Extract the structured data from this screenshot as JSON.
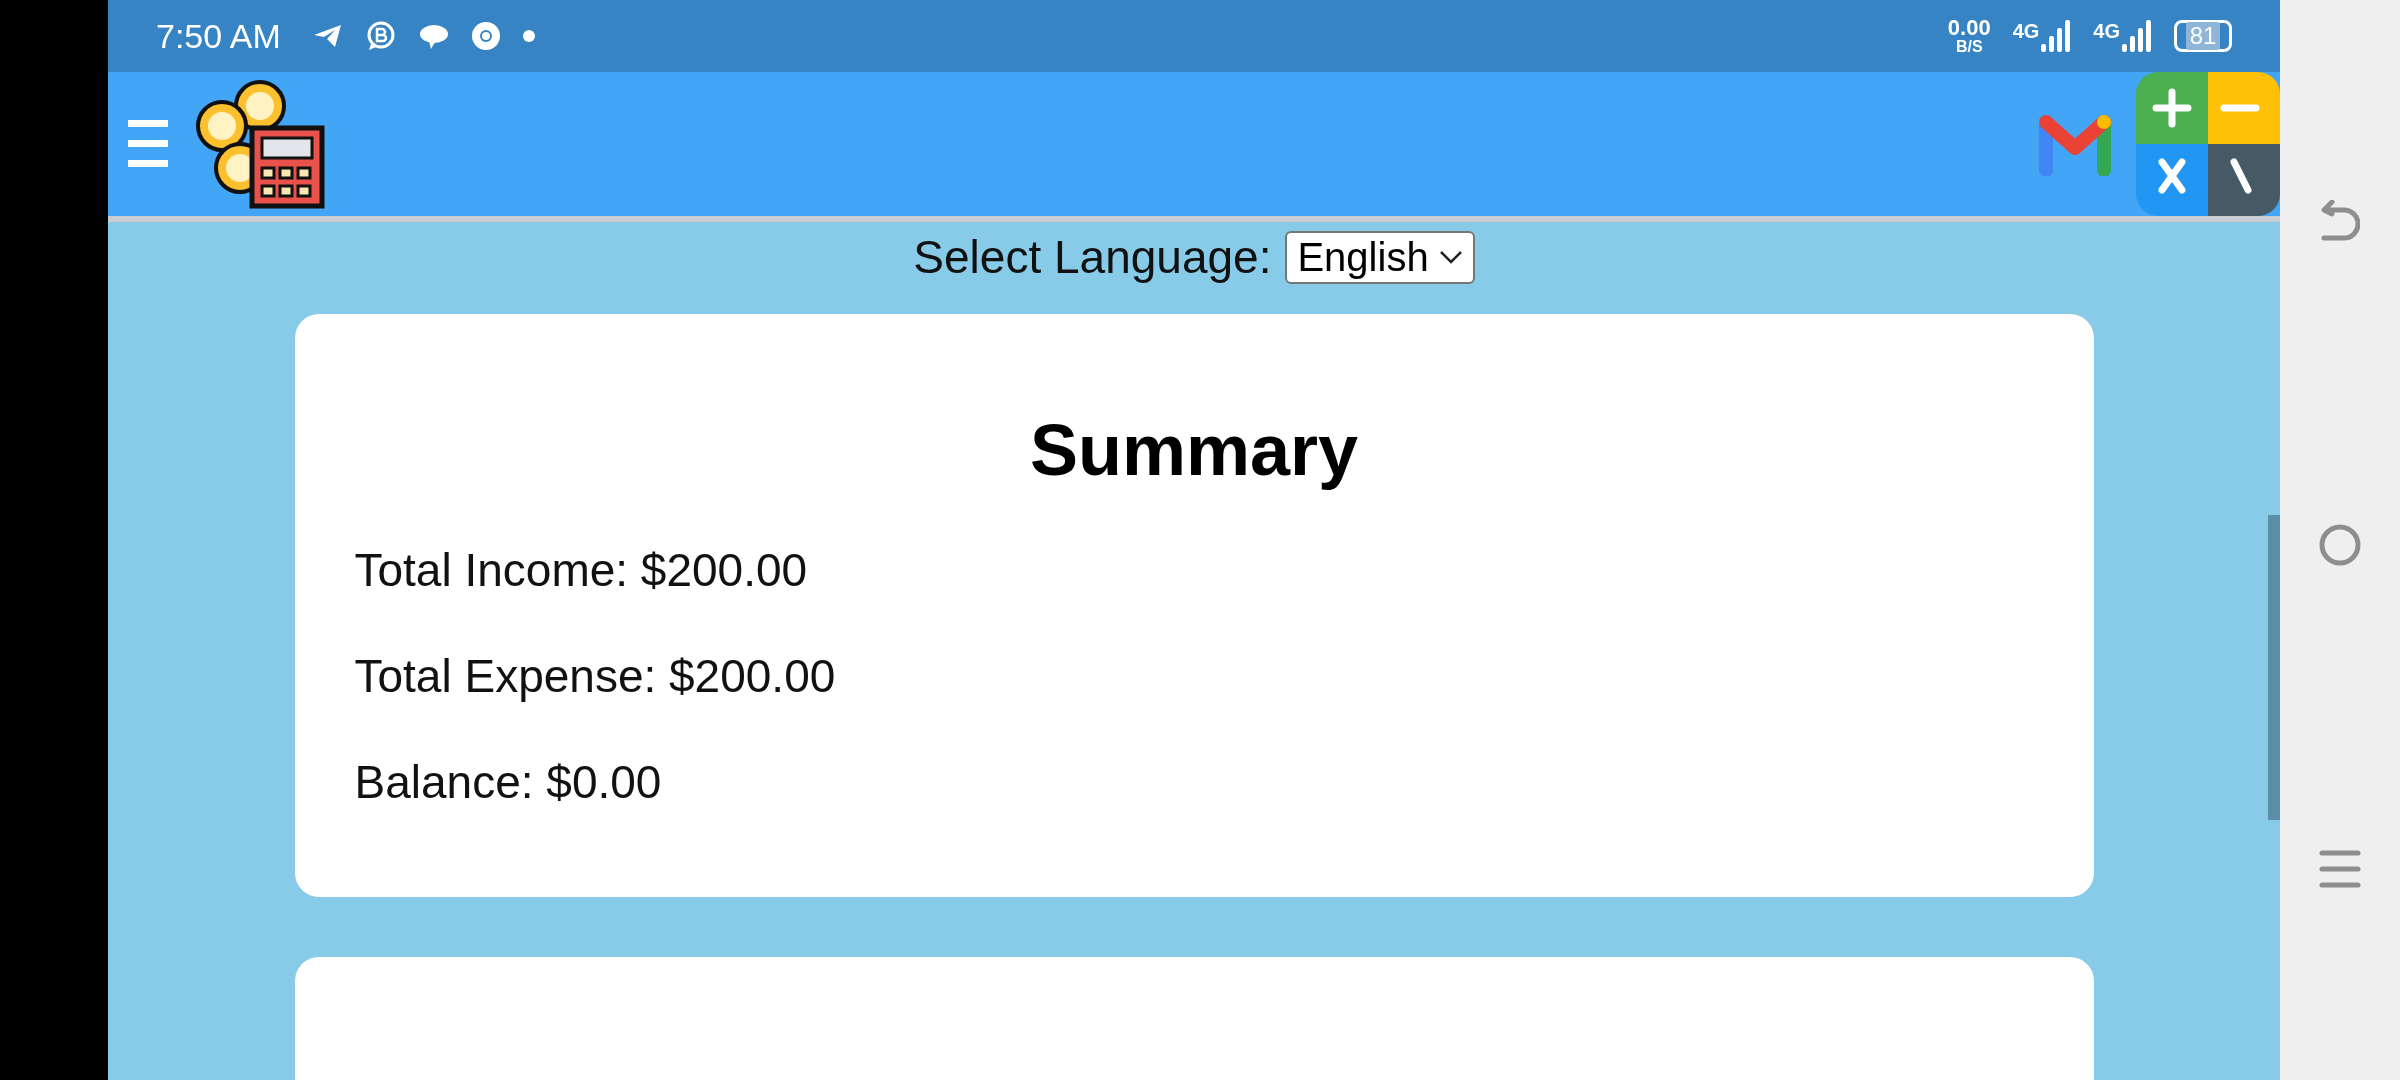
{
  "status_bar": {
    "time": "7:50 AM",
    "net_speed": "0.00",
    "net_unit": "B/S",
    "sim_1": "4G",
    "sim_2": "4G",
    "battery": "81"
  },
  "language": {
    "label": "Select Language:",
    "value": "English"
  },
  "summary": {
    "title": "Summary",
    "lines": [
      "Total Income: $200.00",
      "Total Expense: $200.00",
      "Balance: $0.00"
    ]
  }
}
